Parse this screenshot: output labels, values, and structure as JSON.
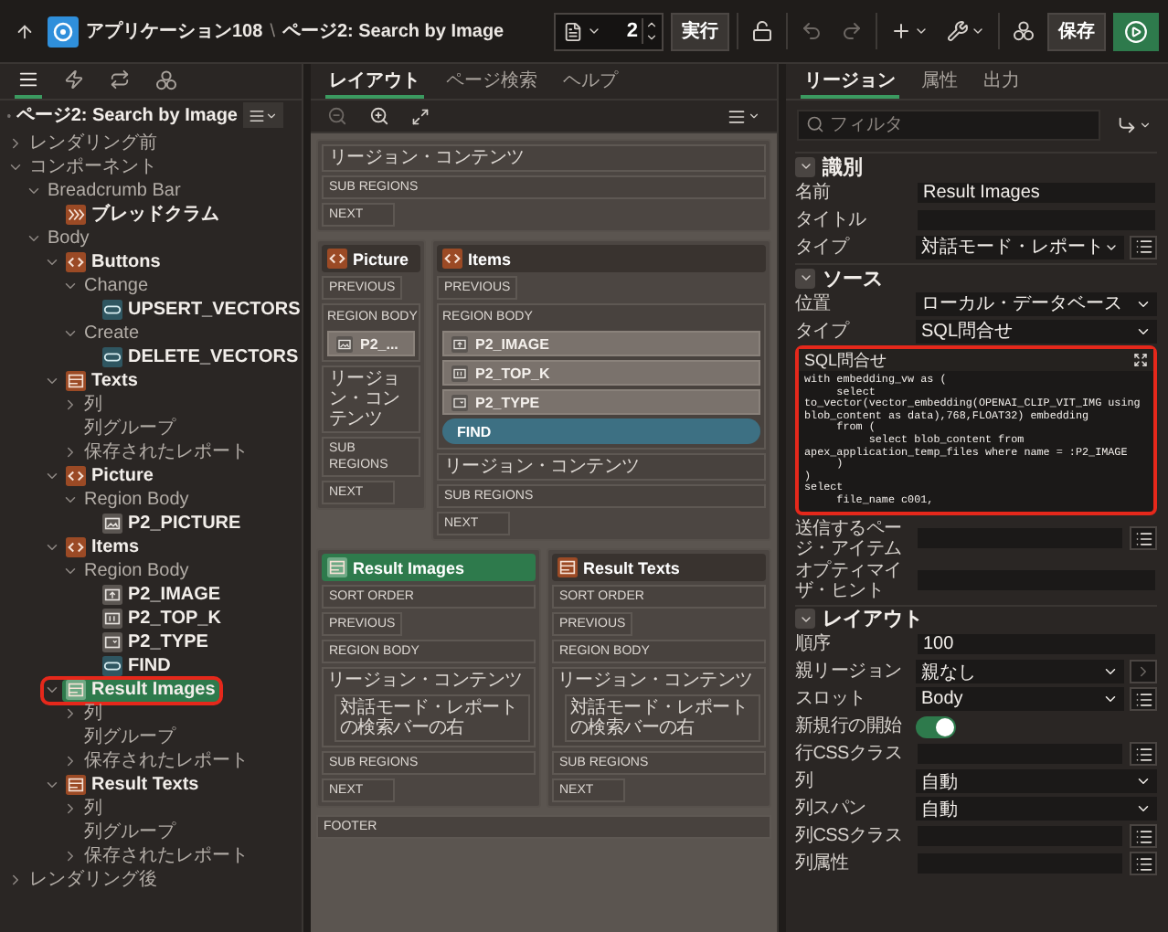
{
  "app_bar": {
    "app": "アプリケーション108",
    "separator": "\\",
    "page": "ページ2: Search by Image",
    "page_number": "2",
    "run": "実行",
    "save": "保存"
  },
  "left_tabs": [
    {
      "kind": "rendering",
      "selected": true
    },
    {
      "kind": "dynamic-actions",
      "selected": false
    },
    {
      "kind": "processing",
      "selected": false
    },
    {
      "kind": "shared",
      "selected": false
    }
  ],
  "tree": {
    "title": "ページ2: Search by Image",
    "nodes": [
      {
        "label": "レンダリング前",
        "expanded": false,
        "selected": false
      },
      {
        "label": "コンポーネント",
        "expanded": true,
        "selected": false,
        "children": [
          {
            "label": "Breadcrumb Bar",
            "expanded": true,
            "selected": false,
            "children": [
              {
                "label": "ブレッドクラム",
                "kind": "breadcrumb",
                "selected": false
              }
            ]
          },
          {
            "label": "Body",
            "expanded": true,
            "selected": false,
            "children": [
              {
                "label": "Buttons",
                "kind": "code",
                "expanded": true,
                "selected": false,
                "children": [
                  {
                    "label": "Change",
                    "expanded": true,
                    "selected": false,
                    "children": [
                      {
                        "label": "UPSERT_VECTORS",
                        "kind": "button",
                        "selected": false
                      }
                    ]
                  },
                  {
                    "label": "Create",
                    "expanded": true,
                    "selected": false,
                    "children": [
                      {
                        "label": "DELETE_VECTORS",
                        "kind": "button",
                        "selected": false
                      }
                    ]
                  }
                ]
              },
              {
                "label": "Texts",
                "kind": "report",
                "expanded": true,
                "selected": false,
                "children": [
                  {
                    "label": "列",
                    "expanded": false,
                    "selected": false
                  },
                  {
                    "label": "列グループ",
                    "selected": false
                  },
                  {
                    "label": "保存されたレポート",
                    "expanded": false,
                    "selected": false
                  }
                ]
              },
              {
                "label": "Picture",
                "kind": "code",
                "expanded": true,
                "selected": false,
                "children": [
                  {
                    "label": "Region Body",
                    "expanded": true,
                    "selected": false,
                    "children": [
                      {
                        "label": "P2_PICTURE",
                        "kind": "image",
                        "selected": false
                      }
                    ]
                  }
                ]
              },
              {
                "label": "Items",
                "kind": "code",
                "expanded": true,
                "selected": false,
                "children": [
                  {
                    "label": "Region Body",
                    "expanded": true,
                    "selected": false,
                    "children": [
                      {
                        "label": "P2_IMAGE",
                        "kind": "file",
                        "selected": false
                      },
                      {
                        "label": "P2_TOP_K",
                        "kind": "number",
                        "selected": false
                      },
                      {
                        "label": "P2_TYPE",
                        "kind": "select",
                        "selected": false
                      },
                      {
                        "label": "FIND",
                        "kind": "button",
                        "selected": false
                      }
                    ]
                  }
                ]
              },
              {
                "label": "Result Images",
                "kind": "report",
                "expanded": true,
                "selected": true,
                "highlighted": true,
                "children": [
                  {
                    "label": "列",
                    "expanded": false,
                    "selected": false
                  },
                  {
                    "label": "列グループ",
                    "selected": false
                  },
                  {
                    "label": "保存されたレポート",
                    "expanded": false,
                    "selected": false
                  }
                ]
              },
              {
                "label": "Result Texts",
                "kind": "report",
                "expanded": true,
                "selected": false,
                "children": [
                  {
                    "label": "列",
                    "expanded": false,
                    "selected": false
                  },
                  {
                    "label": "列グループ",
                    "selected": false
                  },
                  {
                    "label": "保存されたレポート",
                    "expanded": false,
                    "selected": false
                  }
                ]
              }
            ]
          }
        ]
      },
      {
        "label": "レンダリング後",
        "expanded": false,
        "selected": false
      }
    ]
  },
  "layout": {
    "tabs": [
      {
        "label": "レイアウト",
        "selected": true
      },
      {
        "label": "ページ検索",
        "selected": false
      },
      {
        "label": "ヘルプ",
        "selected": false
      }
    ],
    "body_slots": [
      {
        "label": "リージョン・コンテンツ",
        "kind": "contents"
      },
      {
        "label": "SUB REGIONS",
        "kind": "wide"
      },
      {
        "label": "NEXT",
        "kind": "short"
      }
    ],
    "region_rows": [
      [
        {
          "title": "Picture",
          "kind": "code",
          "selected": false,
          "slots": [
            {
              "label": "PREVIOUS",
              "kind": "short"
            },
            {
              "label": "REGION BODY",
              "kind": "body",
              "items": [
                {
                  "label": "P2_...",
                  "kind": "image"
                }
              ]
            },
            {
              "label": "リージョン・コンテンツ",
              "kind": "contents"
            },
            {
              "label": "SUB REGIONS",
              "kind": "wide"
            },
            {
              "label": "NEXT",
              "kind": "short"
            }
          ]
        },
        {
          "title": "Items",
          "kind": "code",
          "selected": false,
          "slots": [
            {
              "label": "PREVIOUS",
              "kind": "short"
            },
            {
              "label": "REGION BODY",
              "kind": "body",
              "items": [
                {
                  "label": "P2_IMAGE",
                  "kind": "file"
                },
                {
                  "label": "P2_TOP_K",
                  "kind": "number"
                },
                {
                  "label": "P2_TYPE",
                  "kind": "select"
                },
                {
                  "label": "FIND",
                  "kind": "button"
                }
              ]
            },
            {
              "label": "リージョン・コンテンツ",
              "kind": "contents"
            },
            {
              "label": "SUB REGIONS",
              "kind": "wide"
            },
            {
              "label": "NEXT",
              "kind": "short"
            }
          ]
        }
      ],
      [
        {
          "title": "Result Images",
          "kind": "report",
          "selected": true,
          "slots": [
            {
              "label": "SORT ORDER",
              "kind": "wide"
            },
            {
              "label": "PREVIOUS",
              "kind": "short"
            },
            {
              "label": "REGION BODY",
              "kind": "wide"
            },
            {
              "label": "リージョン・コンテンツ",
              "kind": "contents",
              "note": "対話モード・レポートの検索バーの右"
            },
            {
              "label": "SUB REGIONS",
              "kind": "wide"
            },
            {
              "label": "NEXT",
              "kind": "short"
            }
          ]
        },
        {
          "title": "Result Texts",
          "kind": "report",
          "selected": false,
          "slots": [
            {
              "label": "SORT ORDER",
              "kind": "wide"
            },
            {
              "label": "PREVIOUS",
              "kind": "short"
            },
            {
              "label": "REGION BODY",
              "kind": "wide"
            },
            {
              "label": "リージョン・コンテンツ",
              "kind": "contents",
              "note": "対話モード・レポートの検索バーの右"
            },
            {
              "label": "SUB REGIONS",
              "kind": "wide"
            },
            {
              "label": "NEXT",
              "kind": "short"
            }
          ]
        }
      ]
    ],
    "footer": "FOOTER"
  },
  "properties": {
    "tabs": [
      {
        "label": "リージョン",
        "selected": true
      },
      {
        "label": "属性",
        "selected": false
      },
      {
        "label": "出力",
        "selected": false
      }
    ],
    "filter": {
      "placeholder": "フィルタ"
    },
    "sections": [
      {
        "title": "識別",
        "expanded": true,
        "rows": [
          {
            "label": "名前",
            "kind": "text",
            "value": "Result Images"
          },
          {
            "label": "タイトル",
            "kind": "text"
          },
          {
            "label": "タイプ",
            "kind": "select",
            "value": "対話モード・レポート",
            "list_button": true
          }
        ]
      },
      {
        "title": "ソース",
        "expanded": true,
        "rows": [
          {
            "label": "位置",
            "kind": "select",
            "value": "ローカル・データベース"
          },
          {
            "label": "タイプ",
            "kind": "select",
            "value": "SQL問合せ"
          },
          {
            "label": "SQL問合せ",
            "kind": "code",
            "highlighted": true,
            "lines": [
              "with embedding_vw as (",
              "     select",
              "to_vector(vector_embedding(OPENAI_CLIP_VIT_IMG using",
              "blob_content as data),768,FLOAT32) embedding",
              "     from (",
              "          select blob_content from",
              "apex_application_temp_files where name = :P2_IMAGE",
              "     )",
              ")",
              "select",
              "     file_name c001,"
            ]
          },
          {
            "label": "送信するページ・アイテム",
            "kind": "text",
            "list_button": true
          },
          {
            "label": "オプティマイザ・ヒント",
            "kind": "text"
          }
        ]
      },
      {
        "title": "レイアウト",
        "expanded": true,
        "rows": [
          {
            "label": "順序",
            "kind": "text",
            "value": "100"
          },
          {
            "label": "親リージョン",
            "kind": "select",
            "value": "親なし",
            "nav_button": true
          },
          {
            "label": "スロット",
            "kind": "select",
            "value": "Body",
            "list_button": true
          },
          {
            "label": "新規行の開始",
            "kind": "switch",
            "on": true
          },
          {
            "label": "行CSSクラス",
            "kind": "text",
            "list_button": true
          },
          {
            "label": "列",
            "kind": "select",
            "value": "自動"
          },
          {
            "label": "列スパン",
            "kind": "select",
            "value": "自動"
          },
          {
            "label": "列CSSクラス",
            "kind": "text",
            "list_button": true
          },
          {
            "label": "列属性",
            "kind": "text",
            "list_button": true
          }
        ]
      }
    ]
  }
}
